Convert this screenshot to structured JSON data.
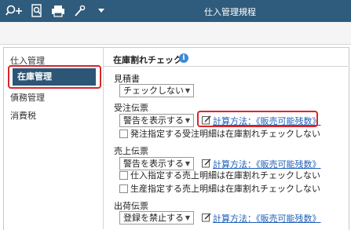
{
  "window": {
    "title": "仕入管理規程"
  },
  "toolbar": {
    "icons": [
      "search-add-icon",
      "search-document-icon",
      "print-icon",
      "settings-icon",
      "chevron-down-icon"
    ]
  },
  "sidebar": {
    "items": [
      {
        "label": "仕入管理",
        "active": false
      },
      {
        "label": "在庫管理",
        "active": true
      },
      {
        "label": "債務管理",
        "active": false
      },
      {
        "label": "消費税",
        "active": false
      }
    ]
  },
  "main": {
    "title": "在庫割れチェック",
    "quotation": {
      "label": "見積書",
      "value": "チェックしない"
    },
    "order_slip": {
      "label": "受注伝票",
      "value": "警告を表示する",
      "link": "計算方法：《販売可能残数》",
      "checks": [
        "発注指定する受注明細は在庫割れチェックしない"
      ]
    },
    "sales_slip": {
      "label": "売上伝票",
      "value": "警告を表示する",
      "link": "計算方法：《販売可能残数》",
      "checks": [
        "仕入指定する売上明細は在庫割れチェックしない",
        "生産指定する売上明細は在庫割れチェックしない"
      ]
    },
    "shipping_slip": {
      "label": "出荷伝票",
      "value": "登録を禁止する",
      "link": "計算方法：《販売可能残数》"
    }
  },
  "colors": {
    "titlebar": "#2f5b7c",
    "active_item": "#2d5575",
    "highlight": "#d9262a",
    "link": "#1f5fb8"
  }
}
